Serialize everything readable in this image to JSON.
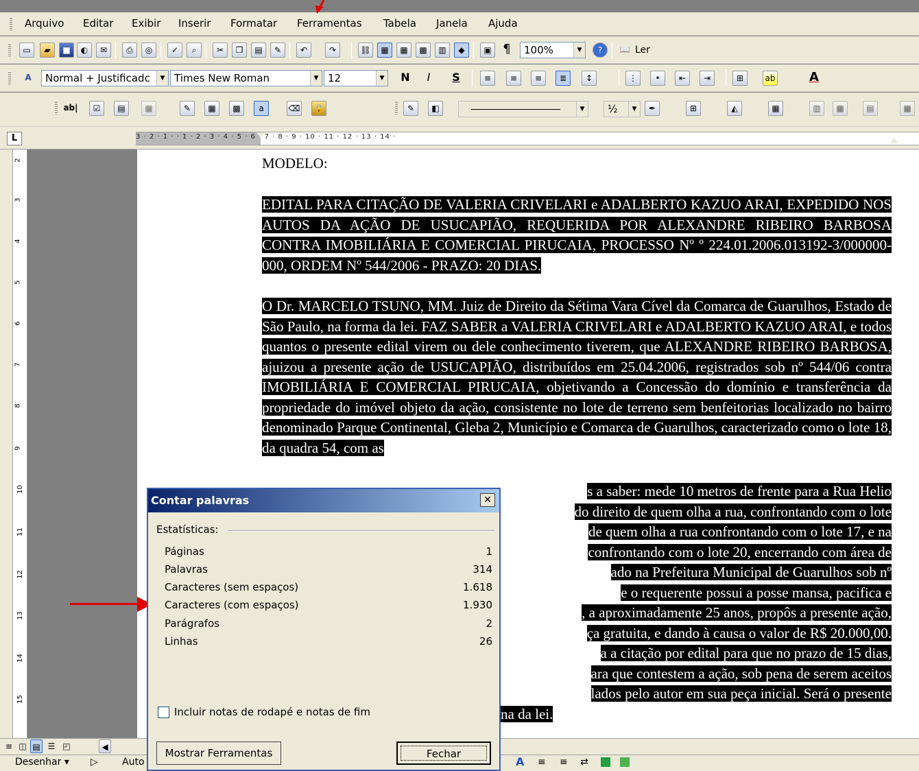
{
  "menu": [
    "Arquivo",
    "Editar",
    "Exibir",
    "Inserir",
    "Formatar",
    "Ferramentas",
    "Tabela",
    "Janela",
    "Ajuda"
  ],
  "toolbar": {
    "zoom": "100%",
    "read": "Ler",
    "style": "Normal + Justificadc",
    "font": "Times New Roman",
    "size": "12",
    "bold": "N",
    "italic": "I",
    "underline": "S",
    "para": "¶",
    "half": "½"
  },
  "ruler": {
    "h": "3 · 2 · 1 · · 1 · 2 · 3 · 4 · 5 · 6 · 7 · 8 · 9 · 10 · 11 · 12 · 13 · 14 ·",
    "v": [
      "2",
      "3",
      "4",
      "5",
      "6",
      "7",
      "8",
      "9",
      "10",
      "11",
      "12",
      "13",
      "14",
      "15"
    ]
  },
  "doc": {
    "modelo": "MODELO:",
    "title": "EDITAL PARA CITAÇÃO DE VALERIA CRIVELARI e ADALBERTO KAZUO ARAI, EXPEDIDO NOS AUTOS DA AÇÃO DE USUCAPIÃO, REQUERIDA POR ALEXANDRE RIBEIRO BARBOSA CONTRA IMOBILIÁRIA E COMERCIAL PIRUCAIA, PROCESSO Nº º 224.01.2006.013192-3/000000-000, ORDEM Nº 544/2006 - PRAZO: 20 DIAS.",
    "body": "O Dr. MARCELO TSUNO, MM. Juiz de Direito da Sétima Vara Cível da Comarca de Guarulhos, Estado de São Paulo, na forma da lei. FAZ SABER a VALERIA CRIVELARI e ADALBERTO KAZUO ARAI, e todos quantos o presente edital virem ou dele conhecimento tiverem, que ALEXANDRE RIBEIRO BARBOSA, ajuizou a presente ação de USUCAPIÃO, distribuídos em 25.04.2006, registrados sob nº 544/06 contra IMOBILIÁRIA E COMERCIAL PIRUCAIA, objetivando a Concessão do domínio e transferência da propriedade do imóvel objeto da ação, consistente no lote de terreno sem benfeitorias localizado no bairro denominado Parque Continental, Gleba 2, Município e Comarca de Guarulhos, caracterizado como o lote 18, da quadra 54, com as",
    "r1": "s a saber: mede 10 metros de frente para a Rua Helio",
    "r2": "do direito de quem olha a rua, confrontando com o lote",
    "r3": "de quem olha a rua confrontando com o lote 17, e na",
    "r4": "confrontando com o lote 20, encerrando com área de",
    "r5": "ado na Prefeitura Municipal de Guarulhos sob nº",
    "r6": "e o requerente possui a posse mansa, pacifica e",
    "r7": ", a aproximadamente 25 anos, propôs a presente ação,",
    "r8": "ça gratuita, e dando à causa o valor de R$ 20.000,00.",
    "r9": "a a citação por edital para que no prazo de 15 dias,",
    "r10": "ara que contestem a ação, sob pena de serem aceitos",
    "r11": "lados pelo autor em sua peça inicial. Será o presente",
    "r12": "na da lei."
  },
  "status": {
    "draw": "Desenhar ▾",
    "auto": "Auto"
  },
  "dialog": {
    "title": "Contar palavras",
    "group": "Estatísticas:",
    "stats": [
      {
        "label": "Páginas",
        "value": "1"
      },
      {
        "label": "Palavras",
        "value": "314"
      },
      {
        "label": "Caracteres (sem espaços)",
        "value": "1.618"
      },
      {
        "label": "Caracteres (com espaços)",
        "value": "1.930"
      },
      {
        "label": "Parágrafos",
        "value": "2"
      },
      {
        "label": "Linhas",
        "value": "26"
      }
    ],
    "checkbox": "Incluir notas de rodapé e notas de fim",
    "btn_tools": "Mostrar Ferramentas",
    "btn_close": "Fechar"
  }
}
